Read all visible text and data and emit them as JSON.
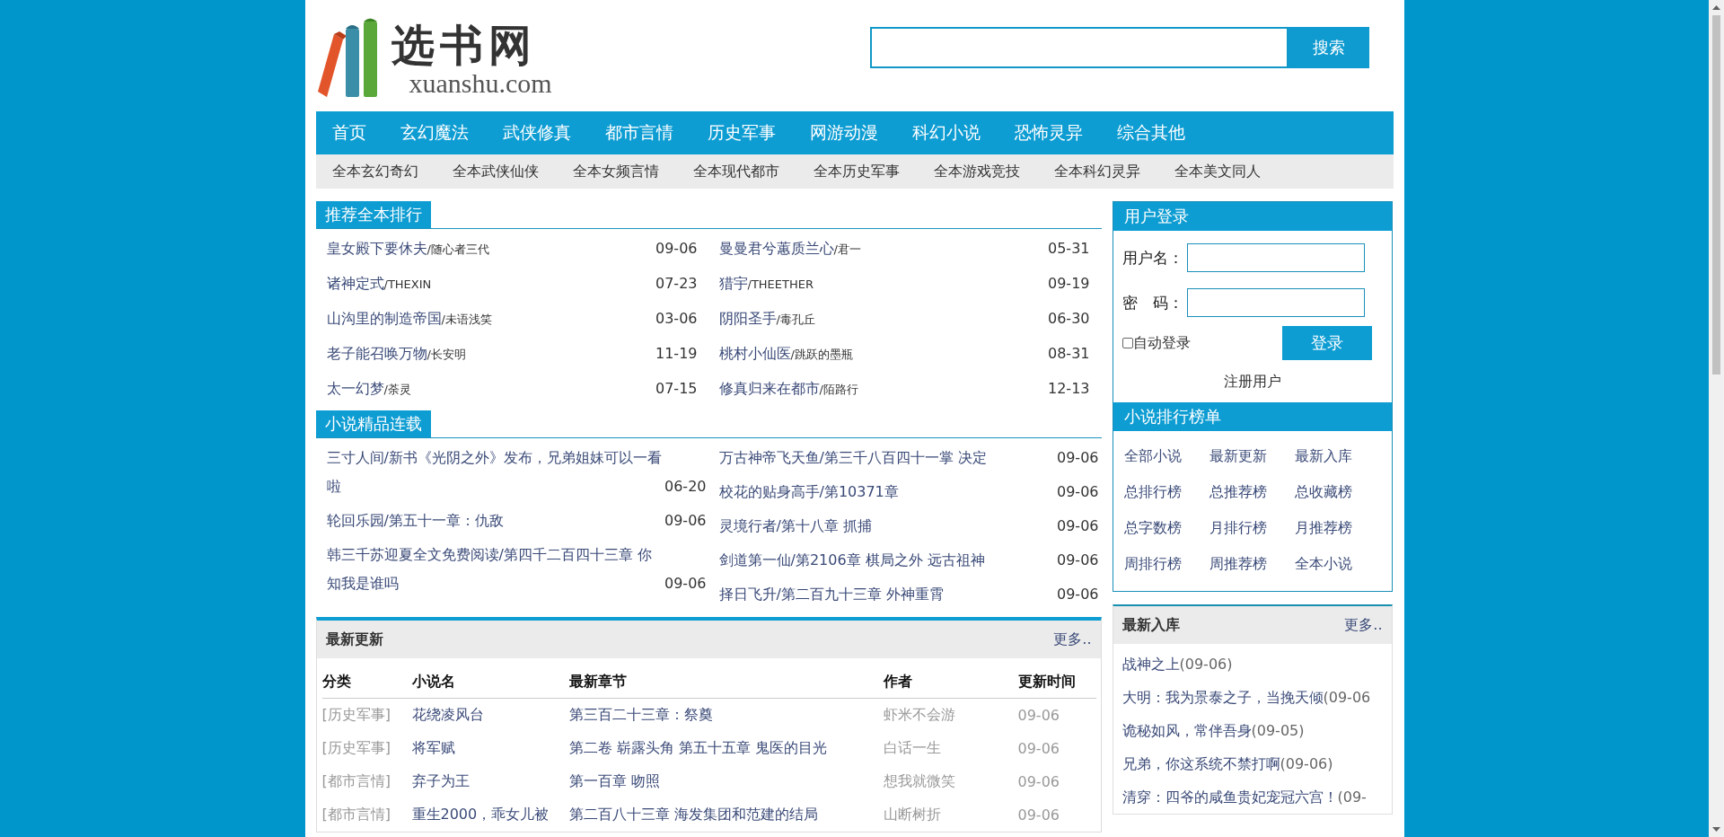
{
  "logo": {
    "title": "选书网",
    "domain": "xuanshu.com"
  },
  "search": {
    "button": "搜索"
  },
  "nav": [
    "首页",
    "玄幻魔法",
    "武侠修真",
    "都市言情",
    "历史军事",
    "网游动漫",
    "科幻小说",
    "恐怖灵异",
    "综合其他"
  ],
  "subnav": [
    "全本玄幻奇幻",
    "全本武侠仙侠",
    "全本女频言情",
    "全本现代都市",
    "全本历史军事",
    "全本游戏竞技",
    "全本科幻灵异",
    "全本美文同人"
  ],
  "recommended": {
    "title": "推荐全本排行",
    "columns": [
      [
        {
          "title": "皇女殿下要休夫",
          "author": "/随心者三代",
          "date": "09-06"
        },
        {
          "title": "诸神定式",
          "author": "/THEXIN",
          "date": "07-23"
        },
        {
          "title": "山沟里的制造帝国",
          "author": "/未语浅笑",
          "date": "03-06"
        },
        {
          "title": "老子能召唤万物",
          "author": "/长安明",
          "date": "11-19"
        },
        {
          "title": "太一幻梦",
          "author": "/荼灵",
          "date": "07-15"
        }
      ],
      [
        {
          "title": "曼曼君兮蕙质兰心",
          "author": "/君一",
          "date": "05-31"
        },
        {
          "title": "猎宇",
          "author": "/THEETHER",
          "date": "09-19"
        },
        {
          "title": "阴阳圣手",
          "author": "/毒孔丘",
          "date": "06-30"
        },
        {
          "title": "桃村小仙医",
          "author": "/跳跃的墨瓶",
          "date": "08-31"
        },
        {
          "title": "修真归来在都市",
          "author": "/陌路行",
          "date": "12-13"
        }
      ]
    ]
  },
  "serials": {
    "title": "小说精品连载",
    "columns": [
      [
        {
          "text": "三寸人间/新书《光阴之外》发布，兄弟姐妹可以一看啦",
          "date": "06-20"
        },
        {
          "text": "轮回乐园/第五十一章：仇敌",
          "date": "09-06"
        },
        {
          "text": "韩三千苏迎夏全文免费阅读/第四千二百四十三章 你知我是谁吗",
          "date": "09-06"
        }
      ],
      [
        {
          "text": "万古神帝飞天鱼/第三千八百四十一掌 决定",
          "date": "09-06"
        },
        {
          "text": "校花的贴身高手/第10371章",
          "date": "09-06"
        },
        {
          "text": "灵境行者/第十八章 抓捕",
          "date": "09-06"
        },
        {
          "text": "剑道第一仙/第2106章 棋局之外 远古祖神",
          "date": "09-06"
        },
        {
          "text": "择日飞升/第二百九十三章 外神重霄",
          "date": "09-06"
        }
      ]
    ]
  },
  "login": {
    "title": "用户登录",
    "username_label": "用户名：",
    "password_label": "密　码：",
    "remember": {
      "label": "自动登录",
      "checked": false
    },
    "button": "登录",
    "register": "注册用户"
  },
  "rankings": {
    "title": "小说排行榜单",
    "links": [
      "全部小说",
      "最新更新",
      "最新入库",
      "总排行榜",
      "总推荐榜",
      "总收藏榜",
      "总字数榜",
      "月排行榜",
      "月推荐榜",
      "周排行榜",
      "周推荐榜",
      "全本小说"
    ]
  },
  "latest_updates": {
    "title": "最新更新",
    "more": "更多..",
    "columns": [
      "分类",
      "小说名",
      "最新章节",
      "作者",
      "更新时间"
    ],
    "rows": [
      {
        "category": "[历史军事]",
        "name": "花绕凌风台",
        "chapter": "第三百二十三章：祭奠",
        "author": "虾米不会游",
        "time": "09-06"
      },
      {
        "category": "[历史军事]",
        "name": "将军赋",
        "chapter": "第二卷 崭露头角 第五十五章 鬼医的目光",
        "author": "白话一生",
        "time": "09-06"
      },
      {
        "category": "[都市言情]",
        "name": "弃子为王",
        "chapter": "第一百章 吻照",
        "author": "想我就微笑",
        "time": "09-06"
      },
      {
        "category": "[都市言情]",
        "name": "重生2000，乖女儿被",
        "chapter": "第二百八十三章 海发集团和范建的结局",
        "author": "山断树折",
        "time": "09-06"
      }
    ]
  },
  "latest_added": {
    "title": "最新入库",
    "more": "更多..",
    "items": [
      {
        "name": "战神之上",
        "date": "(09-06)"
      },
      {
        "name": "大明：我为景泰之子，当挽天倾",
        "date": "(09-06"
      },
      {
        "name": "诡秘如风，常伴吾身",
        "date": "(09-05)"
      },
      {
        "name": "兄弟，你这系统不禁打啊",
        "date": "(09-06)"
      },
      {
        "name": "清穿：四爷的咸鱼贵妃宠冠六宫！",
        "date": "(09-"
      }
    ]
  }
}
